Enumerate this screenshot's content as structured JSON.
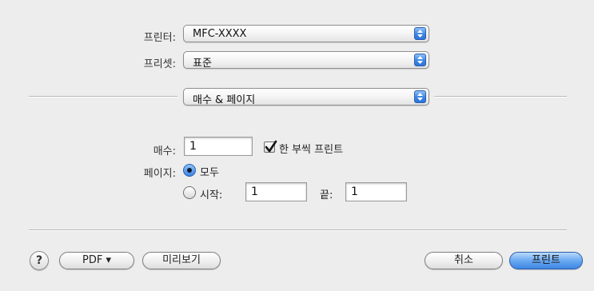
{
  "printer": {
    "label": "프린터:",
    "value": "MFC-XXXX"
  },
  "presets": {
    "label": "프리셋:",
    "value": "표준"
  },
  "section": {
    "value": "매수 & 페이지"
  },
  "copies": {
    "label": "매수:",
    "value": "1",
    "collate_label": "한 부씩 프린트",
    "collate_checked": true
  },
  "pages": {
    "label": "페이지:",
    "all_label": "모두",
    "from_label": "시작:",
    "from_value": "1",
    "to_label": "끝:",
    "to_value": "1",
    "selected": "all"
  },
  "footer": {
    "help_label": "?",
    "pdf_label": "PDF ▾",
    "preview_label": "미리보기",
    "cancel_label": "취소",
    "print_label": "프린트"
  }
}
